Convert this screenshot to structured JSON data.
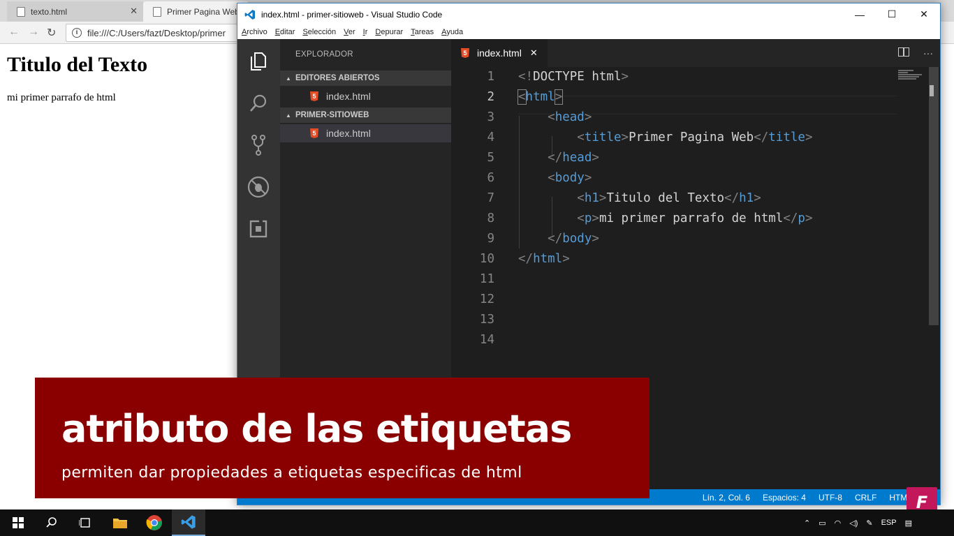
{
  "browser": {
    "tabs": [
      {
        "label": "texto.html"
      },
      {
        "label": "Primer Pagina Web"
      }
    ],
    "address": "file:///C:/Users/fazt/Desktop/primer",
    "page": {
      "heading": "Titulo del Texto",
      "paragraph": "mi primer parrafo de html"
    }
  },
  "vscode": {
    "window_title": "index.html - primer-sitioweb - Visual Studio Code",
    "menu": [
      "Archivo",
      "Editar",
      "Selección",
      "Ver",
      "Ir",
      "Depurar",
      "Tareas",
      "Ayuda"
    ],
    "sidebar": {
      "title": "EXPLORADOR",
      "sections": [
        {
          "label": "EDITORES ABIERTOS",
          "files": [
            "index.html"
          ]
        },
        {
          "label": "PRIMER-SITIOWEB",
          "files": [
            "index.html"
          ]
        }
      ]
    },
    "editor_tab": "index.html",
    "line_numbers": [
      "1",
      "2",
      "3",
      "4",
      "5",
      "6",
      "7",
      "8",
      "9",
      "10",
      "11",
      "12",
      "13",
      "14"
    ],
    "code": {
      "doctype": "DOCTYPE html",
      "html": "html",
      "head": "head",
      "title": "title",
      "title_text": "Primer Pagina Web",
      "body": "body",
      "h1": "h1",
      "h1_text": "Titulo del Texto",
      "p": "p",
      "p_text": "mi primer parrafo de html"
    },
    "status": {
      "position": "Lín. 2, Col. 6",
      "spaces": "Espacios: 4",
      "encoding": "UTF-8",
      "eol": "CRLF",
      "language": "HTML"
    }
  },
  "overlay": {
    "title": "atributo de las etiquetas",
    "subtitle": "permiten dar propiedades a etiquetas especificas de html",
    "logo": "F"
  },
  "taskbar": {
    "language": "ESP"
  }
}
